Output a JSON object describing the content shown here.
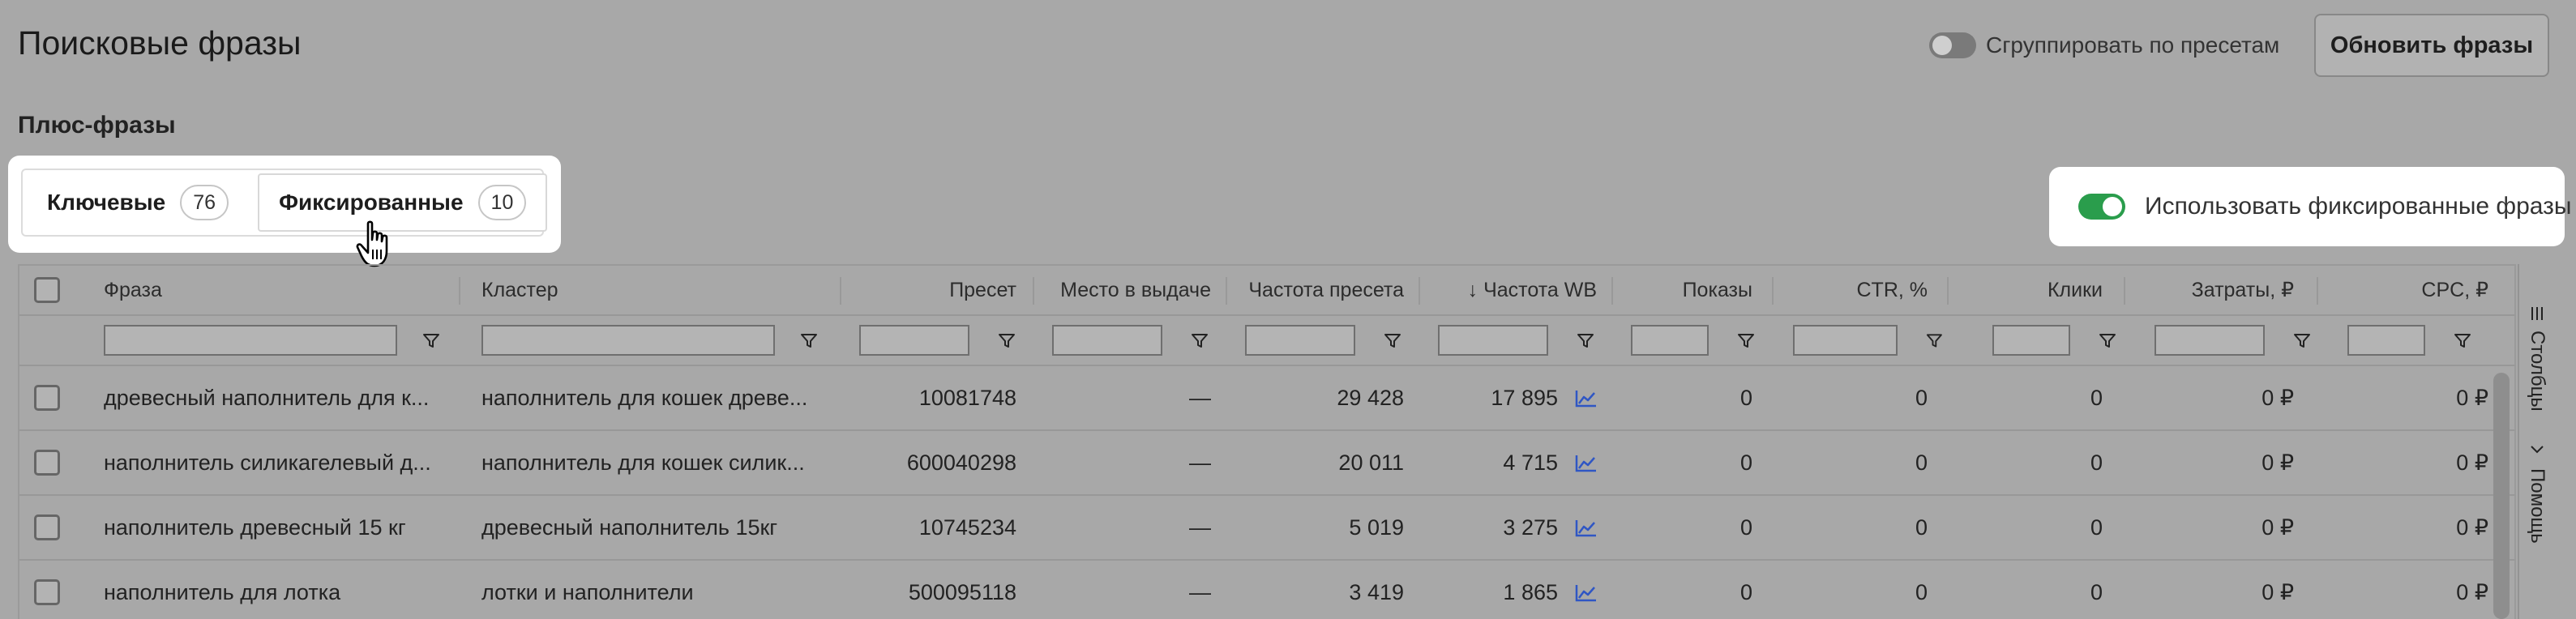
{
  "header": {
    "title": "Поисковые фразы",
    "group_toggle_label": "Сгруппировать по пресетам",
    "group_toggle_on": false,
    "refresh_label": "Обновить фразы"
  },
  "section": {
    "title": "Плюс-фразы"
  },
  "tabs": [
    {
      "label": "Ключевые",
      "count": "76",
      "active": false
    },
    {
      "label": "Фиксированные",
      "count": "10",
      "active": true
    }
  ],
  "fixed_toggle": {
    "label": "Использовать фиксированные фразы",
    "on": true
  },
  "table": {
    "columns": [
      "Фраза",
      "Кластер",
      "Пресет",
      "Место в выдаче",
      "Частота пресета",
      "↓ Частота WB",
      "Показы",
      "CTR, %",
      "Клики",
      "Затраты, ₽",
      "CPC, ₽"
    ],
    "rows": [
      [
        "древесный наполнитель для к...",
        "наполнитель для кошек древе...",
        "10081748",
        "—",
        "29 428",
        "17 895",
        "0",
        "0",
        "0",
        "0 ₽",
        "0 ₽"
      ],
      [
        "наполнитель силикагелевый д...",
        "наполнитель для кошек силик...",
        "600040298",
        "—",
        "20 011",
        "4 715",
        "0",
        "0",
        "0",
        "0 ₽",
        "0 ₽"
      ],
      [
        "наполнитель древесный 15 кг",
        "древесный наполнитель 15кг",
        "10745234",
        "—",
        "5 019",
        "3 275",
        "0",
        "0",
        "0",
        "0 ₽",
        "0 ₽"
      ],
      [
        "наполнитель для лотка",
        "лотки и наполнители",
        "500095118",
        "—",
        "3 419",
        "1 865",
        "0",
        "0",
        "0",
        "0 ₽",
        "0 ₽"
      ]
    ]
  },
  "side_rail": {
    "columns_label": "Столбцы",
    "help_label": "Помощь"
  },
  "colors": {
    "accent_green": "#2a9d4c",
    "trend_blue": "#2f56c4",
    "overlay_gray": "#a8a8a8"
  },
  "icons": [
    "filter-icon",
    "trend-chart-icon",
    "hand-cursor-icon",
    "columns-icon",
    "check-icon"
  ]
}
